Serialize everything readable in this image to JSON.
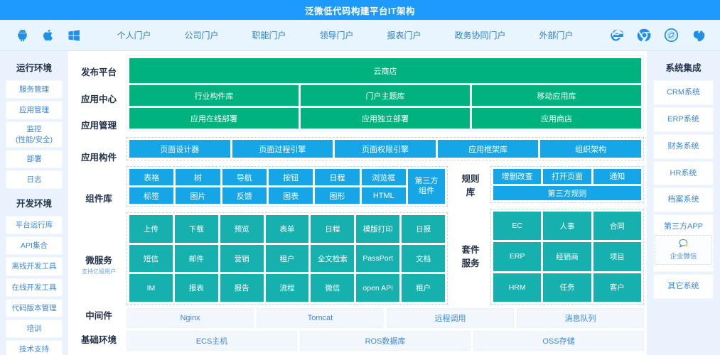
{
  "header": {
    "title": "泛微低代码构建平台IT架构",
    "bg": "#1E9AFF"
  },
  "topnav": {
    "os_icons": [
      {
        "name": "android-icon",
        "label": "Android"
      },
      {
        "name": "apple-icon",
        "label": "Apple"
      },
      {
        "name": "windows-icon",
        "label": "Windows"
      }
    ],
    "items": [
      {
        "label": "个人门户"
      },
      {
        "label": "公司门户"
      },
      {
        "label": "职能门户"
      },
      {
        "label": "领导门户"
      },
      {
        "label": "报表门户"
      },
      {
        "label": "政务协同门户"
      },
      {
        "label": "外部门户"
      }
    ],
    "browser_icons": [
      {
        "name": "internet-explorer-icon",
        "label": "Internet Explorer"
      },
      {
        "name": "chrome-icon",
        "label": "Chrome"
      },
      {
        "name": "safari-icon",
        "label": "Safari"
      },
      {
        "name": "firefox-icon",
        "label": "Firefox"
      }
    ]
  },
  "left_sidebar": {
    "group1_title": "运行环境",
    "group1_items": [
      {
        "label": "服务管理"
      },
      {
        "label": "应用管理"
      },
      {
        "label": "监控",
        "label2": "(性能/安全)"
      },
      {
        "label": "部署"
      },
      {
        "label": "日志"
      }
    ],
    "group2_title": "开发环境",
    "group2_items": [
      {
        "label": "平台运行库"
      },
      {
        "label": "API集合"
      },
      {
        "label": "离线开发工具"
      },
      {
        "label": "在线开发工具"
      },
      {
        "label": "代码版本管理"
      },
      {
        "label": "培训"
      },
      {
        "label": "技术支持"
      }
    ]
  },
  "right_sidebar": {
    "title": "系统集成",
    "items": [
      {
        "label": "CRM系统"
      },
      {
        "label": "ERP系统"
      },
      {
        "label": "财务系统"
      },
      {
        "label": "HR系统"
      },
      {
        "label": "档案系统"
      }
    ],
    "third_party": {
      "title": "第三方APP",
      "app_label": "企业微信",
      "app_icon": "wechat-work-icon"
    },
    "other": {
      "label": "其它系统"
    }
  },
  "rows": {
    "publish_platform": "发布平台",
    "app_center": "应用中心",
    "app_manage": "应用管理",
    "app_component": "应用构件",
    "component_lib": "组件库",
    "microservice": "微服务",
    "microservice_sub": "支持亿级用户",
    "middleware": "中间件",
    "base_env": "基础环境",
    "rule_lib_l1": "规则",
    "rule_lib_l2": "库",
    "suite_l1": "套件",
    "suite_l2": "服务"
  },
  "publish_platform": {
    "cloud_store": "云商店"
  },
  "app_center": [
    {
      "label": "行业构件库"
    },
    {
      "label": "门户主题库"
    },
    {
      "label": "移动应用库"
    }
  ],
  "app_manage": [
    {
      "label": "应用在线部署"
    },
    {
      "label": "应用独立部署"
    },
    {
      "label": "应用商店"
    }
  ],
  "app_component": [
    {
      "label": "页面设计器"
    },
    {
      "label": "页面过程引擎"
    },
    {
      "label": "页面权限引擎"
    },
    {
      "label": "应用框架库"
    },
    {
      "label": "组织架构"
    }
  ],
  "component_lib": {
    "row1": [
      "表格",
      "树",
      "导航",
      "按钮",
      "日程",
      "浏览框"
    ],
    "row2": [
      "标签",
      "图片",
      "反馈",
      "图表",
      "图形",
      "HTML"
    ],
    "third_party_l1": "第三方",
    "third_party_l2": "组件"
  },
  "microservice": {
    "row1": [
      "上传",
      "下载",
      "预览",
      "表单",
      "日程",
      "模版打印",
      "日报"
    ],
    "row2": [
      "短信",
      "邮件",
      "营销",
      "租户",
      "全文检索",
      "PassPort",
      "文档"
    ],
    "row3": [
      "IM",
      "报表",
      "报告",
      "流程",
      "微信",
      "open API",
      "租户"
    ]
  },
  "rule_lib": {
    "row1": [
      "增删改查",
      "打开页面",
      "通知"
    ],
    "row2": "第三方规则"
  },
  "suite_service": {
    "row1": [
      "EC",
      "人事",
      "合同"
    ],
    "row2": [
      "ERP",
      "经销商",
      "项目"
    ],
    "row3": [
      "HRM",
      "任务",
      "客户"
    ]
  },
  "middleware": [
    "Nginx",
    "Tomcat",
    "远程调用",
    "消息队列"
  ],
  "base_env": [
    "ECS主机",
    "ROS数据库",
    "OSS存储"
  ],
  "colors": {
    "green": "#00B37E",
    "blue": "#16A6E8",
    "teal": "#16B0AE",
    "pale": "#F1F7FD",
    "header": "#1E9AFF",
    "sidebar_bg": "#EAF3FD"
  }
}
